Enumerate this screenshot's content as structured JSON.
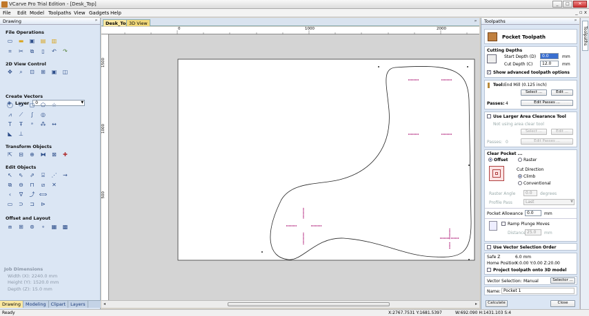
{
  "window": {
    "title": "VCarve Pro Trial Edition - [Desk_Top]",
    "min": "_",
    "max": "□",
    "close": "✕"
  },
  "menu": {
    "items": [
      "File",
      "Edit",
      "Model",
      "Toolpaths",
      "View",
      "Gadgets",
      "Help"
    ],
    "right_controls": "_ ▫ x"
  },
  "left_panel": {
    "title": "Drawing",
    "pin": "ᵖ",
    "sections": {
      "file_ops": "File Operations",
      "view_control": "2D View Control",
      "layer_label": "Layer",
      "layer_value": "0",
      "create_vectors": "Create Vectors",
      "transform": "Transform Objects",
      "edit_objects": "Edit Objects",
      "offset_layout": "Offset and Layout"
    },
    "job_dimensions": {
      "heading": "Job Dimensions",
      "width": "Width  (X): 2240.0 mm",
      "height": "Height (Y): 1520.0 mm",
      "depth": "Depth  (Z): 15.0 mm"
    },
    "tabs": [
      "Drawing",
      "Modeling",
      "Clipart",
      "Layers"
    ]
  },
  "document": {
    "tabs": [
      "Desk_Top",
      "3D View"
    ],
    "ruler_h": [
      "0",
      "1000",
      "2000"
    ],
    "ruler_v": [
      "1500",
      "1000",
      "500"
    ]
  },
  "toolpath_panel": {
    "title": "Toolpaths",
    "pin": "ᵖ",
    "header": "Pocket Toolpath",
    "cutting_depths": {
      "heading": "Cutting Depths",
      "start_label": "Start Depth (D)",
      "start_value": "0.0",
      "cut_label": "Cut Depth (C)",
      "cut_value": "12.0",
      "unit": "mm",
      "advanced": "Show advanced toolpath options"
    },
    "tool": {
      "label": "Tool:",
      "name": "End Mill (0.125 inch)",
      "select": "Select ...",
      "edit": "Edit ...",
      "passes_label": "Passes:",
      "passes_value": "4",
      "edit_passes": "Edit Passes ..."
    },
    "clearance": {
      "checkbox": "Use Larger Area Clearance Tool",
      "not_using": "Not using area clear tool",
      "select": "Select ...",
      "edit": "Edit ...",
      "passes_label": "Passes:",
      "passes_value": "0",
      "edit_passes": "Edit Passes ..."
    },
    "clear_pocket": {
      "heading": "Clear Pocket ...",
      "offset": "Offset",
      "raster": "Raster",
      "cut_direction": "Cut Direction",
      "climb": "Climb",
      "conventional": "Conventional",
      "raster_angle_label": "Raster Angle",
      "raster_angle_value": "0.0",
      "degrees": "degrees",
      "profile_pass_label": "Profile Pass",
      "profile_pass_value": "Last",
      "allowance_label": "Pocket Allowance",
      "allowance_value": "0.0",
      "unit": "mm",
      "ramp": "Ramp Plunge Moves",
      "distance_label": "Distance",
      "distance_value": "25.0",
      "vector_order": "Use Vector Selection Order"
    },
    "positions": {
      "safe_z_label": "Safe Z",
      "safe_z_value": "6.0 mm",
      "home_label": "Home Position",
      "home_value": "X:0.00 Y:0.00 Z:20.00",
      "project": "Project toolpath onto 3D model"
    },
    "vector_selection": {
      "label": "Vector Selection:",
      "value": "Manual",
      "button": "Selector ..."
    },
    "name": {
      "label": "Name:",
      "value": "Pocket 1"
    },
    "calculate": "Calculate",
    "close": "Close",
    "side_tab": "Toolpaths"
  },
  "status": {
    "left": "Ready",
    "coords": "X:2767.7531 Y:1681.5397",
    "size": "W:692.090  H:1431.103  S:4"
  },
  "colors": {
    "panel": "#dbe6f4",
    "tab_active": "#fce9a2",
    "marker": "#b0207a"
  }
}
